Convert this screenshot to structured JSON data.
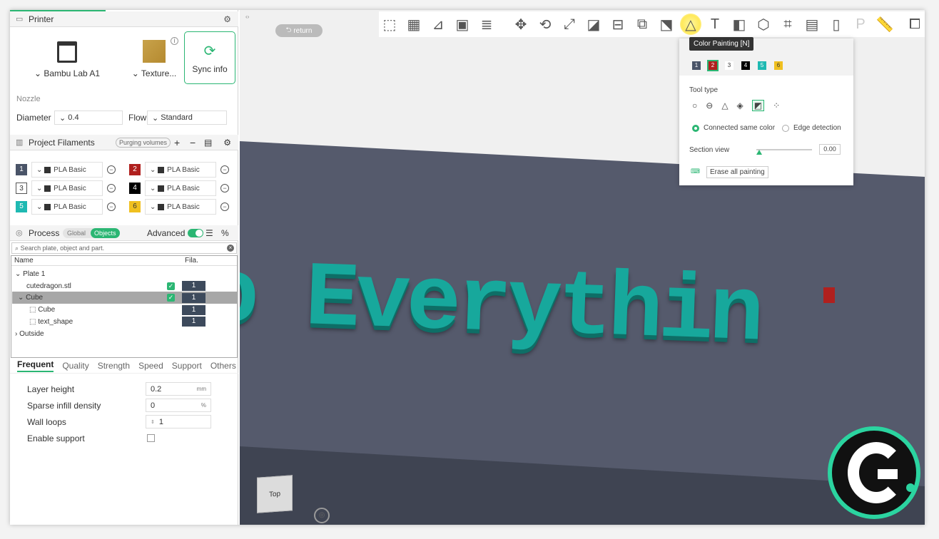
{
  "printer": {
    "section_title": "Printer",
    "printer_name": "Bambu Lab A1",
    "plate_name": "Texture...",
    "sync_label": "Sync info",
    "nozzle_label": "Nozzle",
    "diameter_label": "Diameter",
    "diameter_value": "0.4",
    "flow_label": "Flow",
    "flow_value": "Standard"
  },
  "filaments": {
    "section_title": "Project Filaments",
    "purging_label": "Purging volumes",
    "items": [
      {
        "num": "1",
        "name": "PLA Basic",
        "color": "#4a5468",
        "text": "#ffffff"
      },
      {
        "num": "2",
        "name": "PLA Basic",
        "color": "#b0201e",
        "text": "#ffffff"
      },
      {
        "num": "3",
        "name": "PLA Basic",
        "color": "#ffffff",
        "text": "#333333"
      },
      {
        "num": "4",
        "name": "PLA Basic",
        "color": "#000000",
        "text": "#ffffff"
      },
      {
        "num": "5",
        "name": "PLA Basic",
        "color": "#1fb9b2",
        "text": "#ffffff"
      },
      {
        "num": "6",
        "name": "PLA Basic",
        "color": "#f0c020",
        "text": "#333333"
      }
    ]
  },
  "process": {
    "section_title": "Process",
    "global_label": "Global",
    "objects_label": "Objects",
    "advanced_label": "Advanced",
    "search_placeholder": "Search plate, object and part.",
    "col_name": "Name",
    "col_fila": "Fila.",
    "tree": [
      {
        "label": "Plate 1",
        "fila": ""
      },
      {
        "label": "cutedragon.stl",
        "fila": "1"
      },
      {
        "label": "Cube",
        "fila": "1"
      },
      {
        "label": "Cube",
        "fila": "1"
      },
      {
        "label": "text_shape",
        "fila": "1"
      },
      {
        "label": "Outside",
        "fila": ""
      }
    ]
  },
  "settings": {
    "tabs": [
      "Frequent",
      "Quality",
      "Strength",
      "Speed",
      "Support",
      "Others"
    ],
    "layer_height_label": "Layer height",
    "layer_height_value": "0.2",
    "layer_height_unit": "mm",
    "infill_label": "Sparse infill density",
    "infill_value": "0",
    "infill_unit": "%",
    "walls_label": "Wall loops",
    "walls_value": "1",
    "support_label": "Enable support"
  },
  "viewport": {
    "return_label": "return",
    "model_text": "o Everythin",
    "tooltip": "Color Painting [N]",
    "view_cube_label": "Top"
  },
  "paint_popup": {
    "colors": [
      {
        "num": "1",
        "color": "#4a5468"
      },
      {
        "num": "2",
        "color": "#b0201e"
      },
      {
        "num": "3",
        "color": "#ffffff"
      },
      {
        "num": "4",
        "color": "#000000"
      },
      {
        "num": "5",
        "color": "#1fb9b2"
      },
      {
        "num": "6",
        "color": "#f0c020"
      }
    ],
    "tool_type_label": "Tool type",
    "connected_label": "Connected same color",
    "edge_label": "Edge detection",
    "section_view_label": "Section view",
    "section_value": "0.00",
    "erase_label": "Erase all painting"
  },
  "colors": {
    "accent": "#2bb673",
    "model": "#17a89c",
    "plane": "#555a6c"
  }
}
